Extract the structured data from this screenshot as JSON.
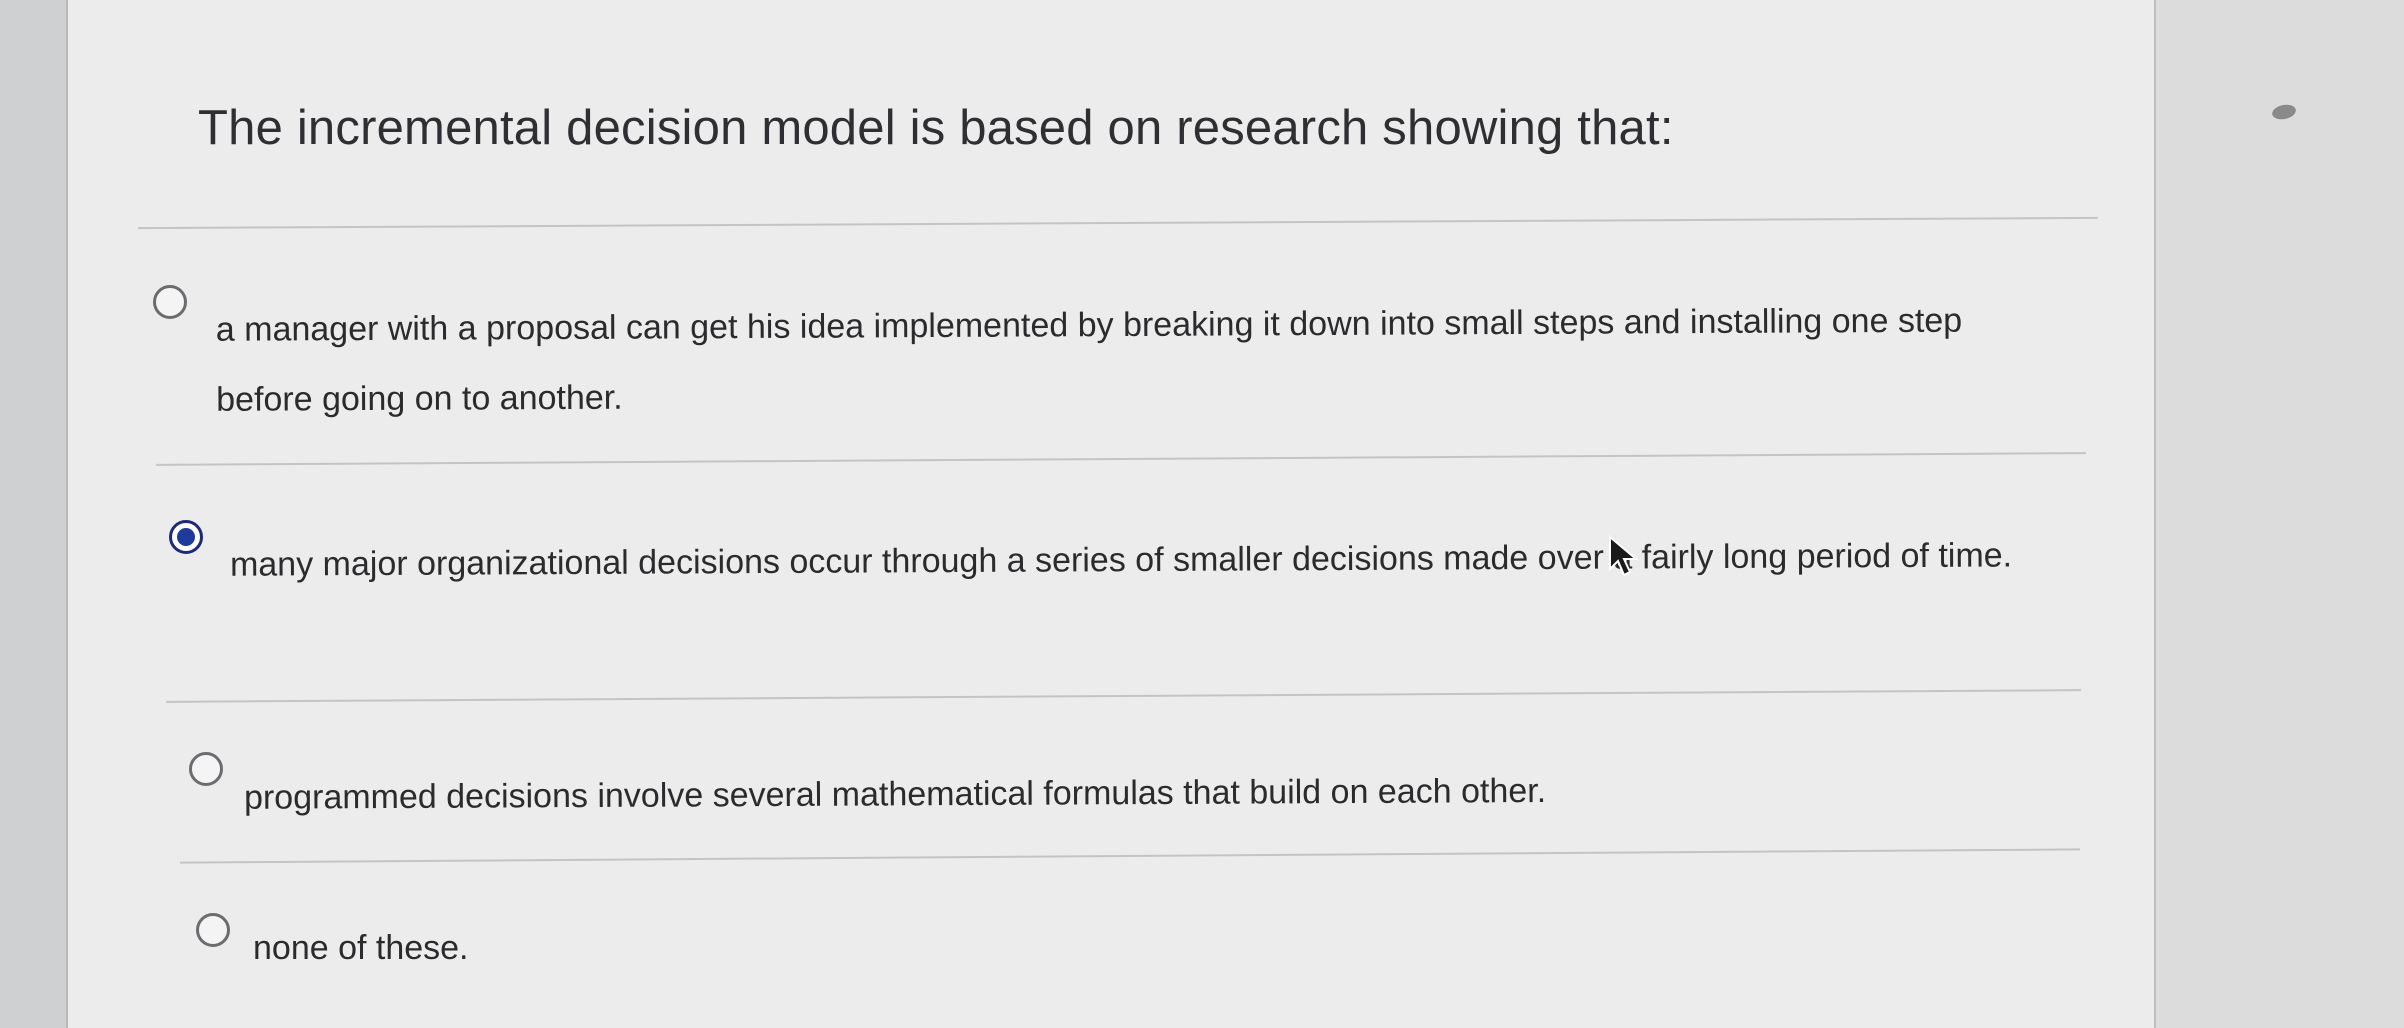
{
  "question": {
    "text": "The incremental decision model is based on research showing that:"
  },
  "options": [
    {
      "text": "a manager with a proposal can get his idea implemented by breaking it down into small steps and installing one step before going on to another.",
      "selected": false
    },
    {
      "text": "many major organizational decisions occur through a series of smaller decisions made over a fairly long period of time.",
      "selected": true
    },
    {
      "text": "programmed decisions involve several mathematical formulas that build on each other.",
      "selected": false
    },
    {
      "text": "none of these.",
      "selected": false
    }
  ],
  "colors": {
    "selected_radio": "#1f3b9a",
    "text": "#2b2b2e",
    "panel_background": "#ececec"
  }
}
